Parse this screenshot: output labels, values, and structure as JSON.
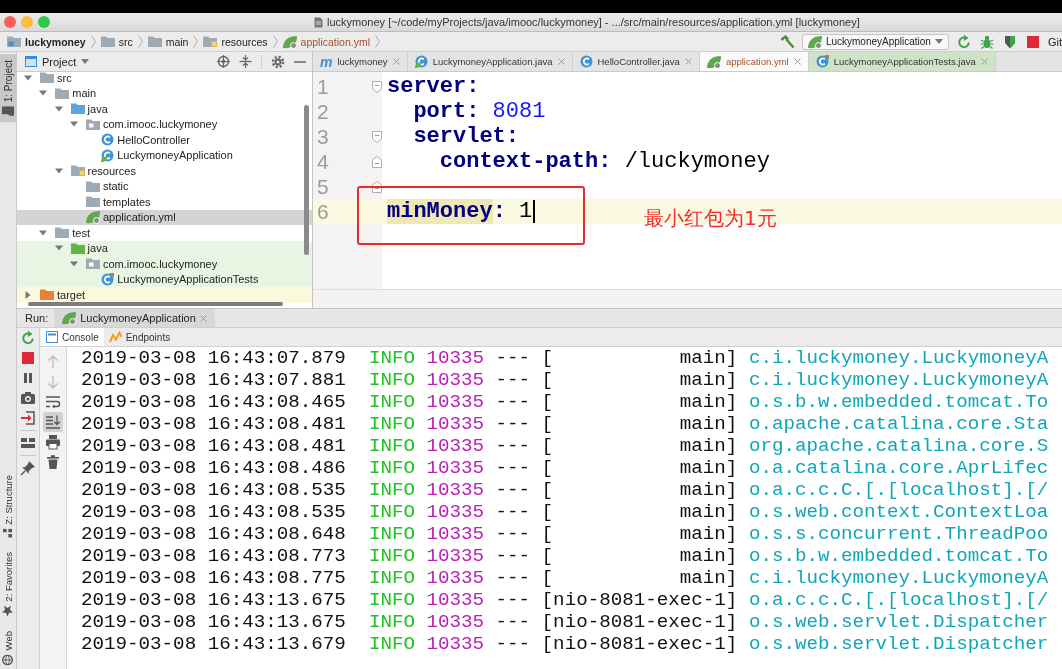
{
  "window": {
    "title": "luckymoney [~/code/myProjects/java/imooc/luckymoney] - .../src/main/resources/application.yml [luckymoney]"
  },
  "breadcrumbs": [
    {
      "label": "luckymoney",
      "kind": "module"
    },
    {
      "label": "src",
      "kind": "folder"
    },
    {
      "label": "main",
      "kind": "folder"
    },
    {
      "label": "resources",
      "kind": "resources-root"
    },
    {
      "label": "application.yml",
      "kind": "yaml"
    }
  ],
  "toolbar": {
    "run_config": "LuckymoneyApplication",
    "vcs_label": "Git"
  },
  "tool_strip": [
    {
      "label": "1: Project",
      "kind": "project",
      "selected": true
    },
    {
      "label": "Z: Structure",
      "kind": "structure",
      "selected": false
    },
    {
      "label": "2: Favorites",
      "kind": "favorites",
      "selected": false
    },
    {
      "label": "Web",
      "kind": "web",
      "selected": false
    }
  ],
  "project_panel": {
    "title": "Project",
    "tree": [
      {
        "label": "src",
        "kind": "folder",
        "expanded": true,
        "selected": false,
        "children": [
          {
            "label": "main",
            "kind": "folder",
            "expanded": true,
            "selected": false,
            "children": [
              {
                "label": "java",
                "kind": "source-root",
                "expanded": true,
                "selected": false,
                "children": [
                  {
                    "label": "com.imooc.luckymoney",
                    "kind": "package",
                    "expanded": true,
                    "selected": false,
                    "children": [
                      {
                        "label": "HelloController",
                        "kind": "class",
                        "selected": false
                      },
                      {
                        "label": "LuckymoneyApplication",
                        "kind": "spring-class",
                        "selected": false
                      }
                    ]
                  }
                ]
              },
              {
                "label": "resources",
                "kind": "resources-root",
                "expanded": true,
                "selected": false,
                "children": [
                  {
                    "label": "static",
                    "kind": "folder",
                    "selected": false
                  },
                  {
                    "label": "templates",
                    "kind": "folder",
                    "selected": false
                  },
                  {
                    "label": "application.yml",
                    "kind": "yaml",
                    "selected": true
                  }
                ]
              }
            ]
          },
          {
            "label": "test",
            "kind": "folder",
            "expanded": true,
            "selected": false,
            "children": [
              {
                "label": "java",
                "kind": "test-root",
                "expanded": true,
                "selected": false,
                "children": [
                  {
                    "label": "com.imooc.luckymoney",
                    "kind": "package",
                    "expanded": true,
                    "selected": false,
                    "children": [
                      {
                        "label": "LuckymoneyApplicationTests",
                        "kind": "test-class",
                        "selected": false
                      }
                    ]
                  }
                ]
              }
            ]
          }
        ]
      },
      {
        "label": "target",
        "kind": "excluded",
        "expanded": false,
        "selected": false
      }
    ]
  },
  "editor": {
    "tabs": [
      {
        "label": "luckymoney",
        "kind": "maven",
        "icon_glyph": "m",
        "selected": false
      },
      {
        "label": "LuckymoneyApplication.java",
        "kind": "spring-class",
        "selected": false
      },
      {
        "label": "HelloController.java",
        "kind": "class",
        "selected": false
      },
      {
        "label": "application.yml",
        "kind": "yaml",
        "selected": true
      },
      {
        "label": "LuckymoneyApplicationTests.java",
        "kind": "test-class",
        "selected": false
      }
    ],
    "lines": [
      {
        "number": "1",
        "current": false,
        "fold": {
          "kind": "start"
        },
        "tokens": [
          {
            "kind": "key",
            "text": "server",
            "highlighted": false
          },
          {
            "kind": "colon",
            "text": ":"
          }
        ],
        "children": [
          {
            "number": "2",
            "current": false,
            "tokens": [
              {
                "kind": "key",
                "text": "port",
                "highlighted": false
              },
              {
                "kind": "colon",
                "text": ":"
              },
              {
                "kind": "number",
                "text": "8081"
              }
            ]
          },
          {
            "number": "3",
            "current": false,
            "fold": {
              "kind": "start"
            },
            "tokens": [
              {
                "kind": "key",
                "text": "servlet",
                "highlighted": false
              },
              {
                "kind": "colon",
                "text": ":"
              }
            ],
            "children": [
              {
                "number": "4",
                "current": false,
                "fold": {
                  "kind": "end"
                },
                "tokens": [
                  {
                    "kind": "key",
                    "text": "context-path",
                    "highlighted": false
                  },
                  {
                    "kind": "colon",
                    "text": ":"
                  },
                  {
                    "kind": "text",
                    "text": "/luckymoney"
                  }
                ]
              }
            ]
          }
        ]
      },
      {
        "number": "5",
        "current": false,
        "fold": {
          "kind": "end"
        }
      },
      {
        "number": "6",
        "current": true,
        "tokens": [
          {
            "kind": "key",
            "text": "minMoney",
            "highlighted": true
          },
          {
            "kind": "colon",
            "text": ":"
          },
          {
            "kind": "text",
            "text": "1"
          }
        ]
      }
    ],
    "annotation": {
      "text": "最小红包为1元"
    }
  },
  "run_panel": {
    "label": "Run:",
    "tab": "LuckymoneyApplication",
    "subtabs": [
      {
        "label": "Console",
        "kind": "console",
        "selected": true
      },
      {
        "label": "Endpoints",
        "kind": "endpoints",
        "selected": false
      }
    ],
    "console_toolbar": [
      {
        "kind": "up",
        "disabled": true,
        "on": false
      },
      {
        "kind": "down",
        "disabled": true,
        "on": false
      },
      {
        "kind": "soft-wrap",
        "disabled": false,
        "on": false
      },
      {
        "kind": "scroll-to-end",
        "disabled": false,
        "on": true
      },
      {
        "kind": "print",
        "disabled": false,
        "on": false
      },
      {
        "kind": "clear",
        "disabled": false,
        "on": false
      }
    ],
    "log": [
      {
        "timestamp": "2019-03-08 16:43:07.879",
        "level": "INFO",
        "pid": "10335",
        "separator": "---",
        "thread": "[           main]",
        "logger": "c.i.luckymoney.LuckymoneyA"
      },
      {
        "timestamp": "2019-03-08 16:43:07.881",
        "level": "INFO",
        "pid": "10335",
        "separator": "---",
        "thread": "[           main]",
        "logger": "c.i.luckymoney.LuckymoneyA"
      },
      {
        "timestamp": "2019-03-08 16:43:08.465",
        "level": "INFO",
        "pid": "10335",
        "separator": "---",
        "thread": "[           main]",
        "logger": "o.s.b.w.embedded.tomcat.To"
      },
      {
        "timestamp": "2019-03-08 16:43:08.481",
        "level": "INFO",
        "pid": "10335",
        "separator": "---",
        "thread": "[           main]",
        "logger": "o.apache.catalina.core.Sta"
      },
      {
        "timestamp": "2019-03-08 16:43:08.481",
        "level": "INFO",
        "pid": "10335",
        "separator": "---",
        "thread": "[           main]",
        "logger": "org.apache.catalina.core.S"
      },
      {
        "timestamp": "2019-03-08 16:43:08.486",
        "level": "INFO",
        "pid": "10335",
        "separator": "---",
        "thread": "[           main]",
        "logger": "o.a.catalina.core.AprLifec"
      },
      {
        "timestamp": "2019-03-08 16:43:08.535",
        "level": "INFO",
        "pid": "10335",
        "separator": "---",
        "thread": "[           main]",
        "logger": "o.a.c.c.C.[.[localhost].[/"
      },
      {
        "timestamp": "2019-03-08 16:43:08.535",
        "level": "INFO",
        "pid": "10335",
        "separator": "---",
        "thread": "[           main]",
        "logger": "o.s.web.context.ContextLoa"
      },
      {
        "timestamp": "2019-03-08 16:43:08.648",
        "level": "INFO",
        "pid": "10335",
        "separator": "---",
        "thread": "[           main]",
        "logger": "o.s.s.concurrent.ThreadPoo"
      },
      {
        "timestamp": "2019-03-08 16:43:08.773",
        "level": "INFO",
        "pid": "10335",
        "separator": "---",
        "thread": "[           main]",
        "logger": "o.s.b.w.embedded.tomcat.To"
      },
      {
        "timestamp": "2019-03-08 16:43:08.775",
        "level": "INFO",
        "pid": "10335",
        "separator": "---",
        "thread": "[           main]",
        "logger": "c.i.luckymoney.LuckymoneyA"
      },
      {
        "timestamp": "2019-03-08 16:43:13.675",
        "level": "INFO",
        "pid": "10335",
        "separator": "---",
        "thread": "[nio-8081-exec-1]",
        "logger": "o.a.c.c.C.[.[localhost].[/"
      },
      {
        "timestamp": "2019-03-08 16:43:13.675",
        "level": "INFO",
        "pid": "10335",
        "separator": "---",
        "thread": "[nio-8081-exec-1]",
        "logger": "o.s.web.servlet.Dispatcher"
      },
      {
        "timestamp": "2019-03-08 16:43:13.679",
        "level": "INFO",
        "pid": "10335",
        "separator": "---",
        "thread": "[nio-8081-exec-1]",
        "logger": "o.s.web.servlet.Dispatcher"
      }
    ]
  }
}
